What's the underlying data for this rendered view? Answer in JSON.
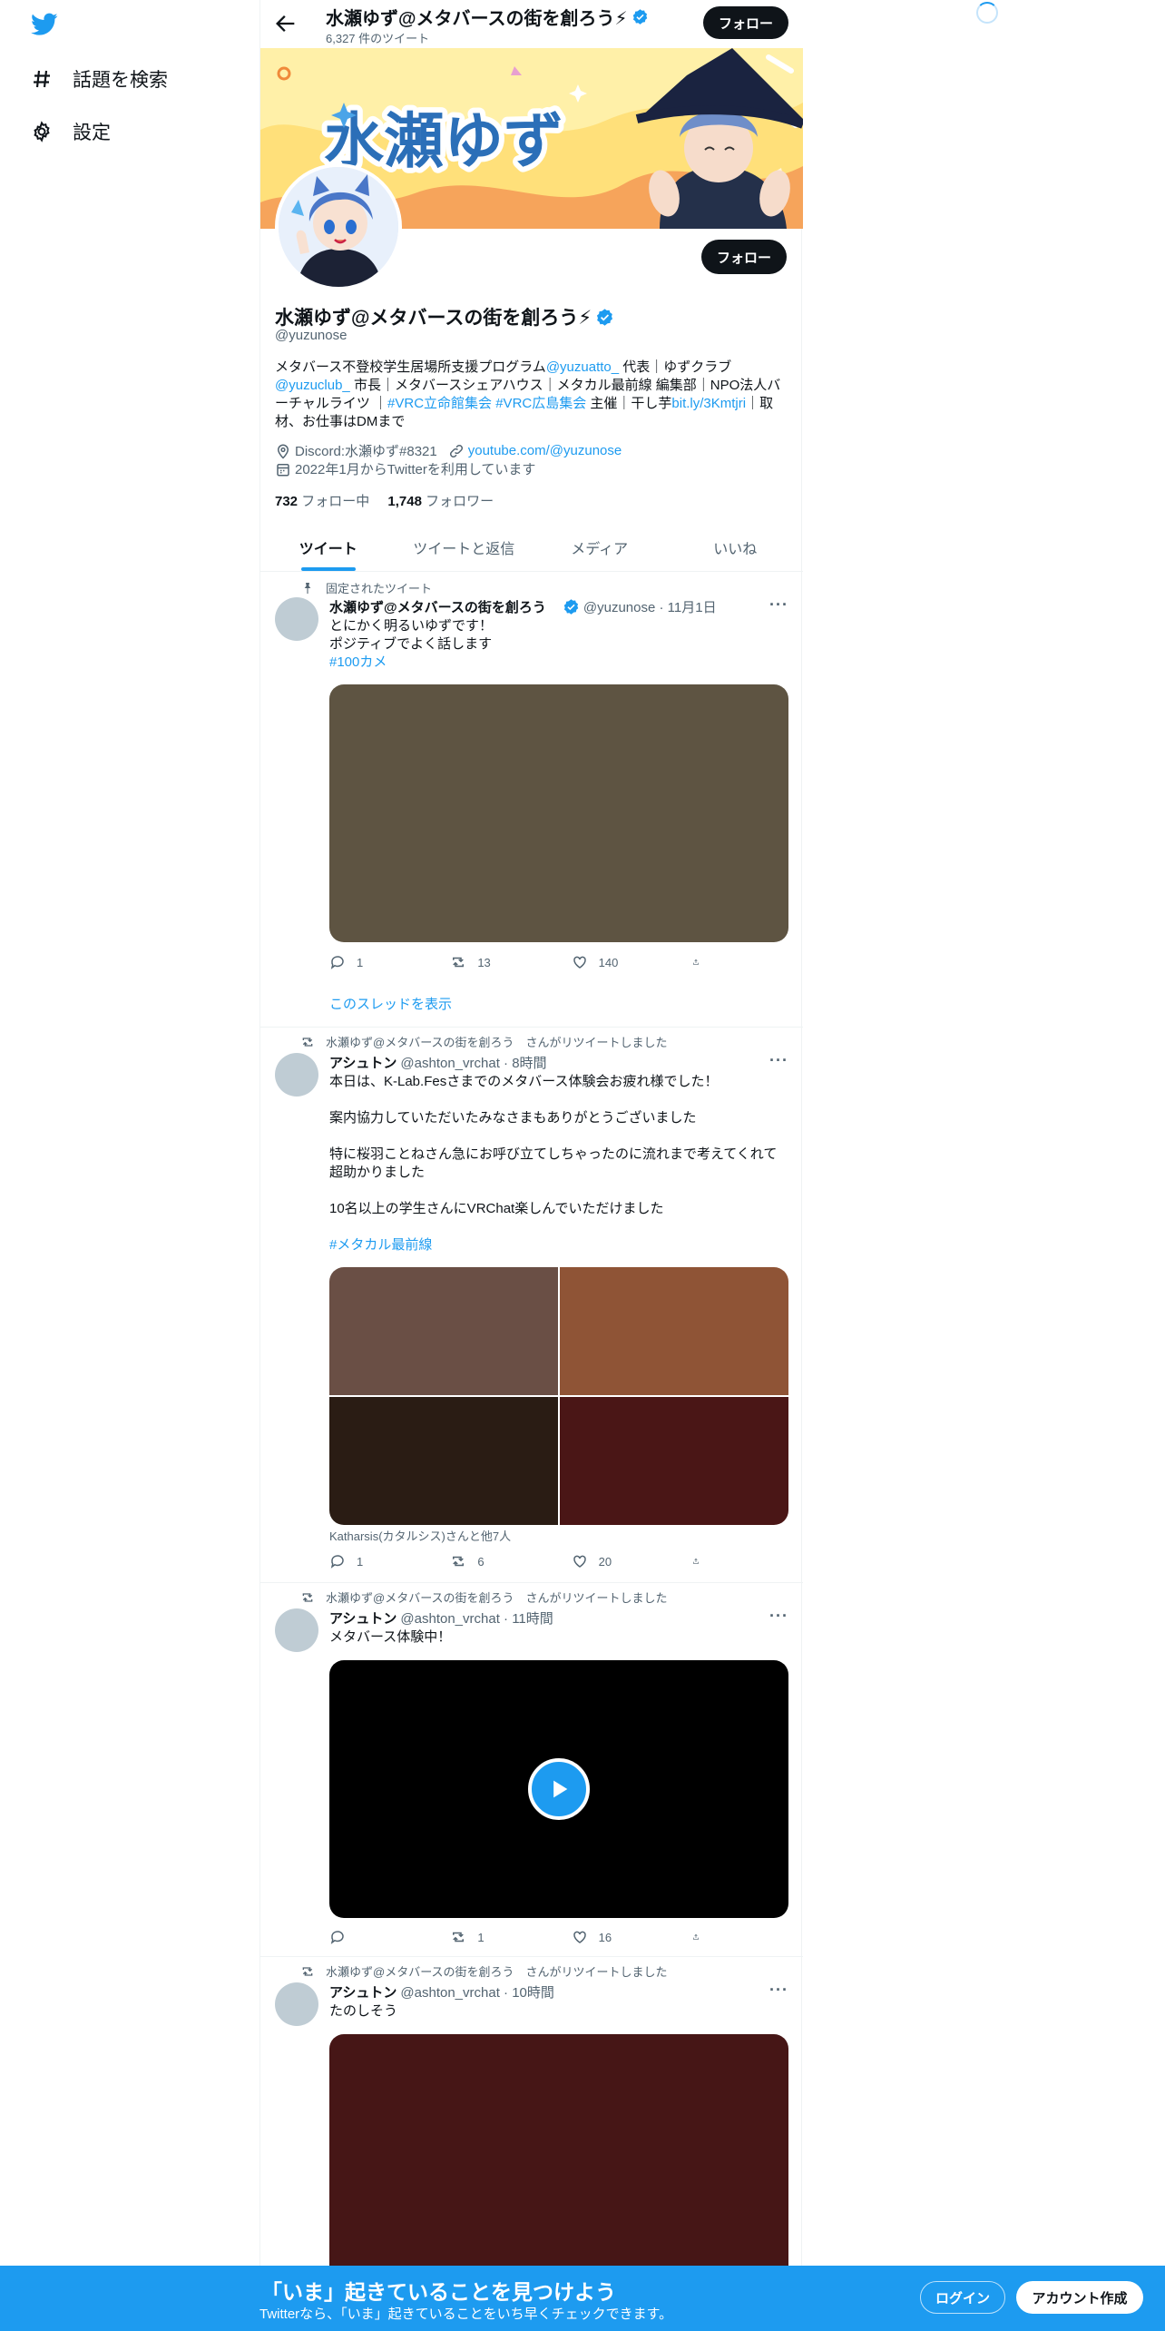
{
  "nav": {
    "explore_label": "話題を検索",
    "settings_label": "設定"
  },
  "topbar": {
    "name": "水瀬ゆず@メタバースの街を創ろう⚡",
    "tweet_count": "6,327 件のツイート",
    "follow_label": "フォロー"
  },
  "profile": {
    "banner_text": "水瀬ゆず",
    "follow_label": "フォロー",
    "name": "水瀬ゆず@メタバースの街を創ろう⚡",
    "handle": "@yuzunose",
    "bio": {
      "p1": "メタバース不登校学生居場所支援プログラム",
      "m1": "@yuzuatto_",
      "p2": " 代表｜ゆずクラブ ",
      "m2": "@yuzuclub_",
      "p3": " 市長｜メタバースシェアハウス｜メタカル最前線 編集部｜NPO法人バーチャルライツ ｜",
      "h1": "#VRC立命館集会",
      "p4": " ",
      "h2": "#VRC広島集会",
      "p5": " 主催｜干し芋",
      "u1": "bit.ly/3Kmtjri",
      "p6": "｜取材、お仕事はDMまで"
    },
    "location": "Discord:水瀬ゆず#8321",
    "website": "youtube.com/@yuzunose",
    "joined": "2022年1月からTwitterを利用しています",
    "following_count": "732",
    "following_label": " フォロー中",
    "followers_count": "1,748",
    "followers_label": " フォロワー"
  },
  "tabs": [
    "ツイート",
    "ツイートと返信",
    "メディア",
    "いいね"
  ],
  "tweets": [
    {
      "context": "固定されたツイート",
      "name": "水瀬ゆず@メタバースの街を創ろう",
      "handle_time": "@yuzunose · 11月1日",
      "text": "とにかく明るいゆずです！\nポジティブでよく話します",
      "hashtag": "#100カメ",
      "replies": "1",
      "retweets": "13",
      "likes": "140",
      "thread_link": "このスレッドを表示",
      "media_color": "#5e5442"
    },
    {
      "context": "水瀬ゆず@メタバースの街を創ろう　さんがリツイートしました",
      "name": "アシュトン",
      "handle_time": "@ashton_vrchat · 8時間",
      "text": "本日は、K-Lab.Fesさまでのメタバース体験会お疲れ様でした！\n\n案内協力していただいたみなさまもありがとうございました\n\n特に桜羽ことねさん急にお呼び立てしちゃったのに流れまで考えてくれて超助かりました\n\n10名以上の学生さんにVRChat楽しんでいただけました",
      "hashtag": "#メタカル最前線",
      "tagged": "Katharsis(カタルシス)さんと他7人",
      "replies": "1",
      "retweets": "6",
      "likes": "20",
      "media_colors": [
        "#6a4f45",
        "#8f5436",
        "#2a1c14",
        "#4a1616"
      ]
    },
    {
      "context": "水瀬ゆず@メタバースの街を創ろう　さんがリツイートしました",
      "name": "アシュトン",
      "handle_time": "@ashton_vrchat · 11時間",
      "text": "メタバース体験中！",
      "replies": "",
      "retweets": "1",
      "likes": "16",
      "media_color": "#000000"
    },
    {
      "context": "水瀬ゆず@メタバースの街を創ろう　さんがリツイートしました",
      "name": "アシュトン",
      "handle_time": "@ashton_vrchat · 10時間",
      "text": "たのしそう",
      "media_color": "#461616"
    }
  ],
  "bottom_bar": {
    "title": "「いま」起きていることを見つけよう",
    "subtitle": "Twitterなら、「いま」起きていることをいち早くチェックできます。",
    "login_label": "ログイン",
    "signup_label": "アカウント作成"
  },
  "colors": {
    "accent": "#1d9bf0",
    "dark_button": "#0f1419",
    "muted_text": "#536471"
  }
}
